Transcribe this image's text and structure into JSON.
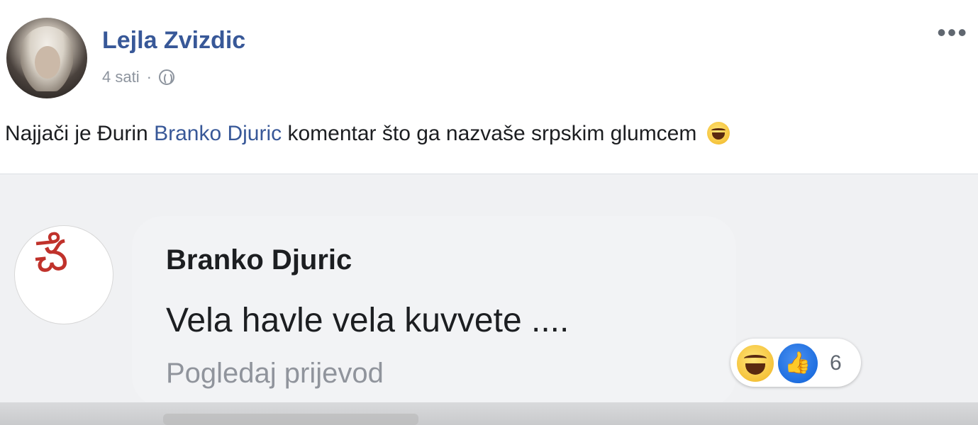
{
  "post": {
    "author": "Lejla Zvizdic",
    "time": "4 sati",
    "separator": "·",
    "more": "•••",
    "text_before": "Najjači je Đurin ",
    "mention": "Branko Djuric",
    "text_after": " komentar što ga nazvaše srpskim glumcem"
  },
  "comment": {
    "author": "Branko Djuric",
    "text": "Vela havle vela kuvvete ....",
    "translate": "Pogledaj prijevod",
    "signature_glyph": "ౘ",
    "reactions": {
      "icons": [
        "haha-icon",
        "like-icon"
      ],
      "like_glyph": "👍",
      "count": "6"
    }
  },
  "colors": {
    "link": "#385898",
    "text": "#1c1e21",
    "muted": "#8d949e",
    "bubble": "#f2f3f5",
    "like_blue": "#1f6fe0"
  }
}
